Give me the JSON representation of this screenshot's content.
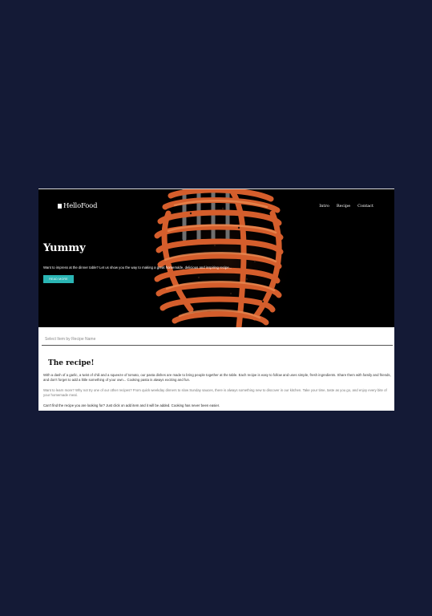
{
  "brand": {
    "name": "HelloFood"
  },
  "nav": {
    "items": [
      {
        "label": "Intro"
      },
      {
        "label": "Recipe"
      },
      {
        "label": "Contact"
      }
    ]
  },
  "hero": {
    "title": "Yummy",
    "text": "Want to impress at the dinner table? Let us show you the way to making a great homemade, delicious and inspiring recipe...",
    "button_label": "READ MORE",
    "image": "spaghetti-on-fork-icon"
  },
  "search": {
    "placeholder": "Select Item by Recipe Name"
  },
  "recipe": {
    "title": "The recipe!",
    "paragraphs": [
      "With a dash of a garlic, a twist of chili and a squeeze of tomato, our pasta dishes are made to bring people together at the table. Each recipe is easy to follow and uses simple, fresh ingredients. Share them with family and friends, and don't forget to add a little something of your own... Cooking pasta is always exciting and fun.",
      "Want to learn more? Why not try one of our other recipes? From quick weekday dinners to slow Sunday sauces, there is always something new to discover in our kitchen. Take your time, taste as you go, and enjoy every bite of your homemade meal.",
      "Can't find the recipe you are looking for? Just click on add item and it will be added. Cooking has never been easier."
    ]
  },
  "colors": {
    "page_bg": "#141a36",
    "accent": "#2ab5b4",
    "hero_bg": "#000000"
  }
}
